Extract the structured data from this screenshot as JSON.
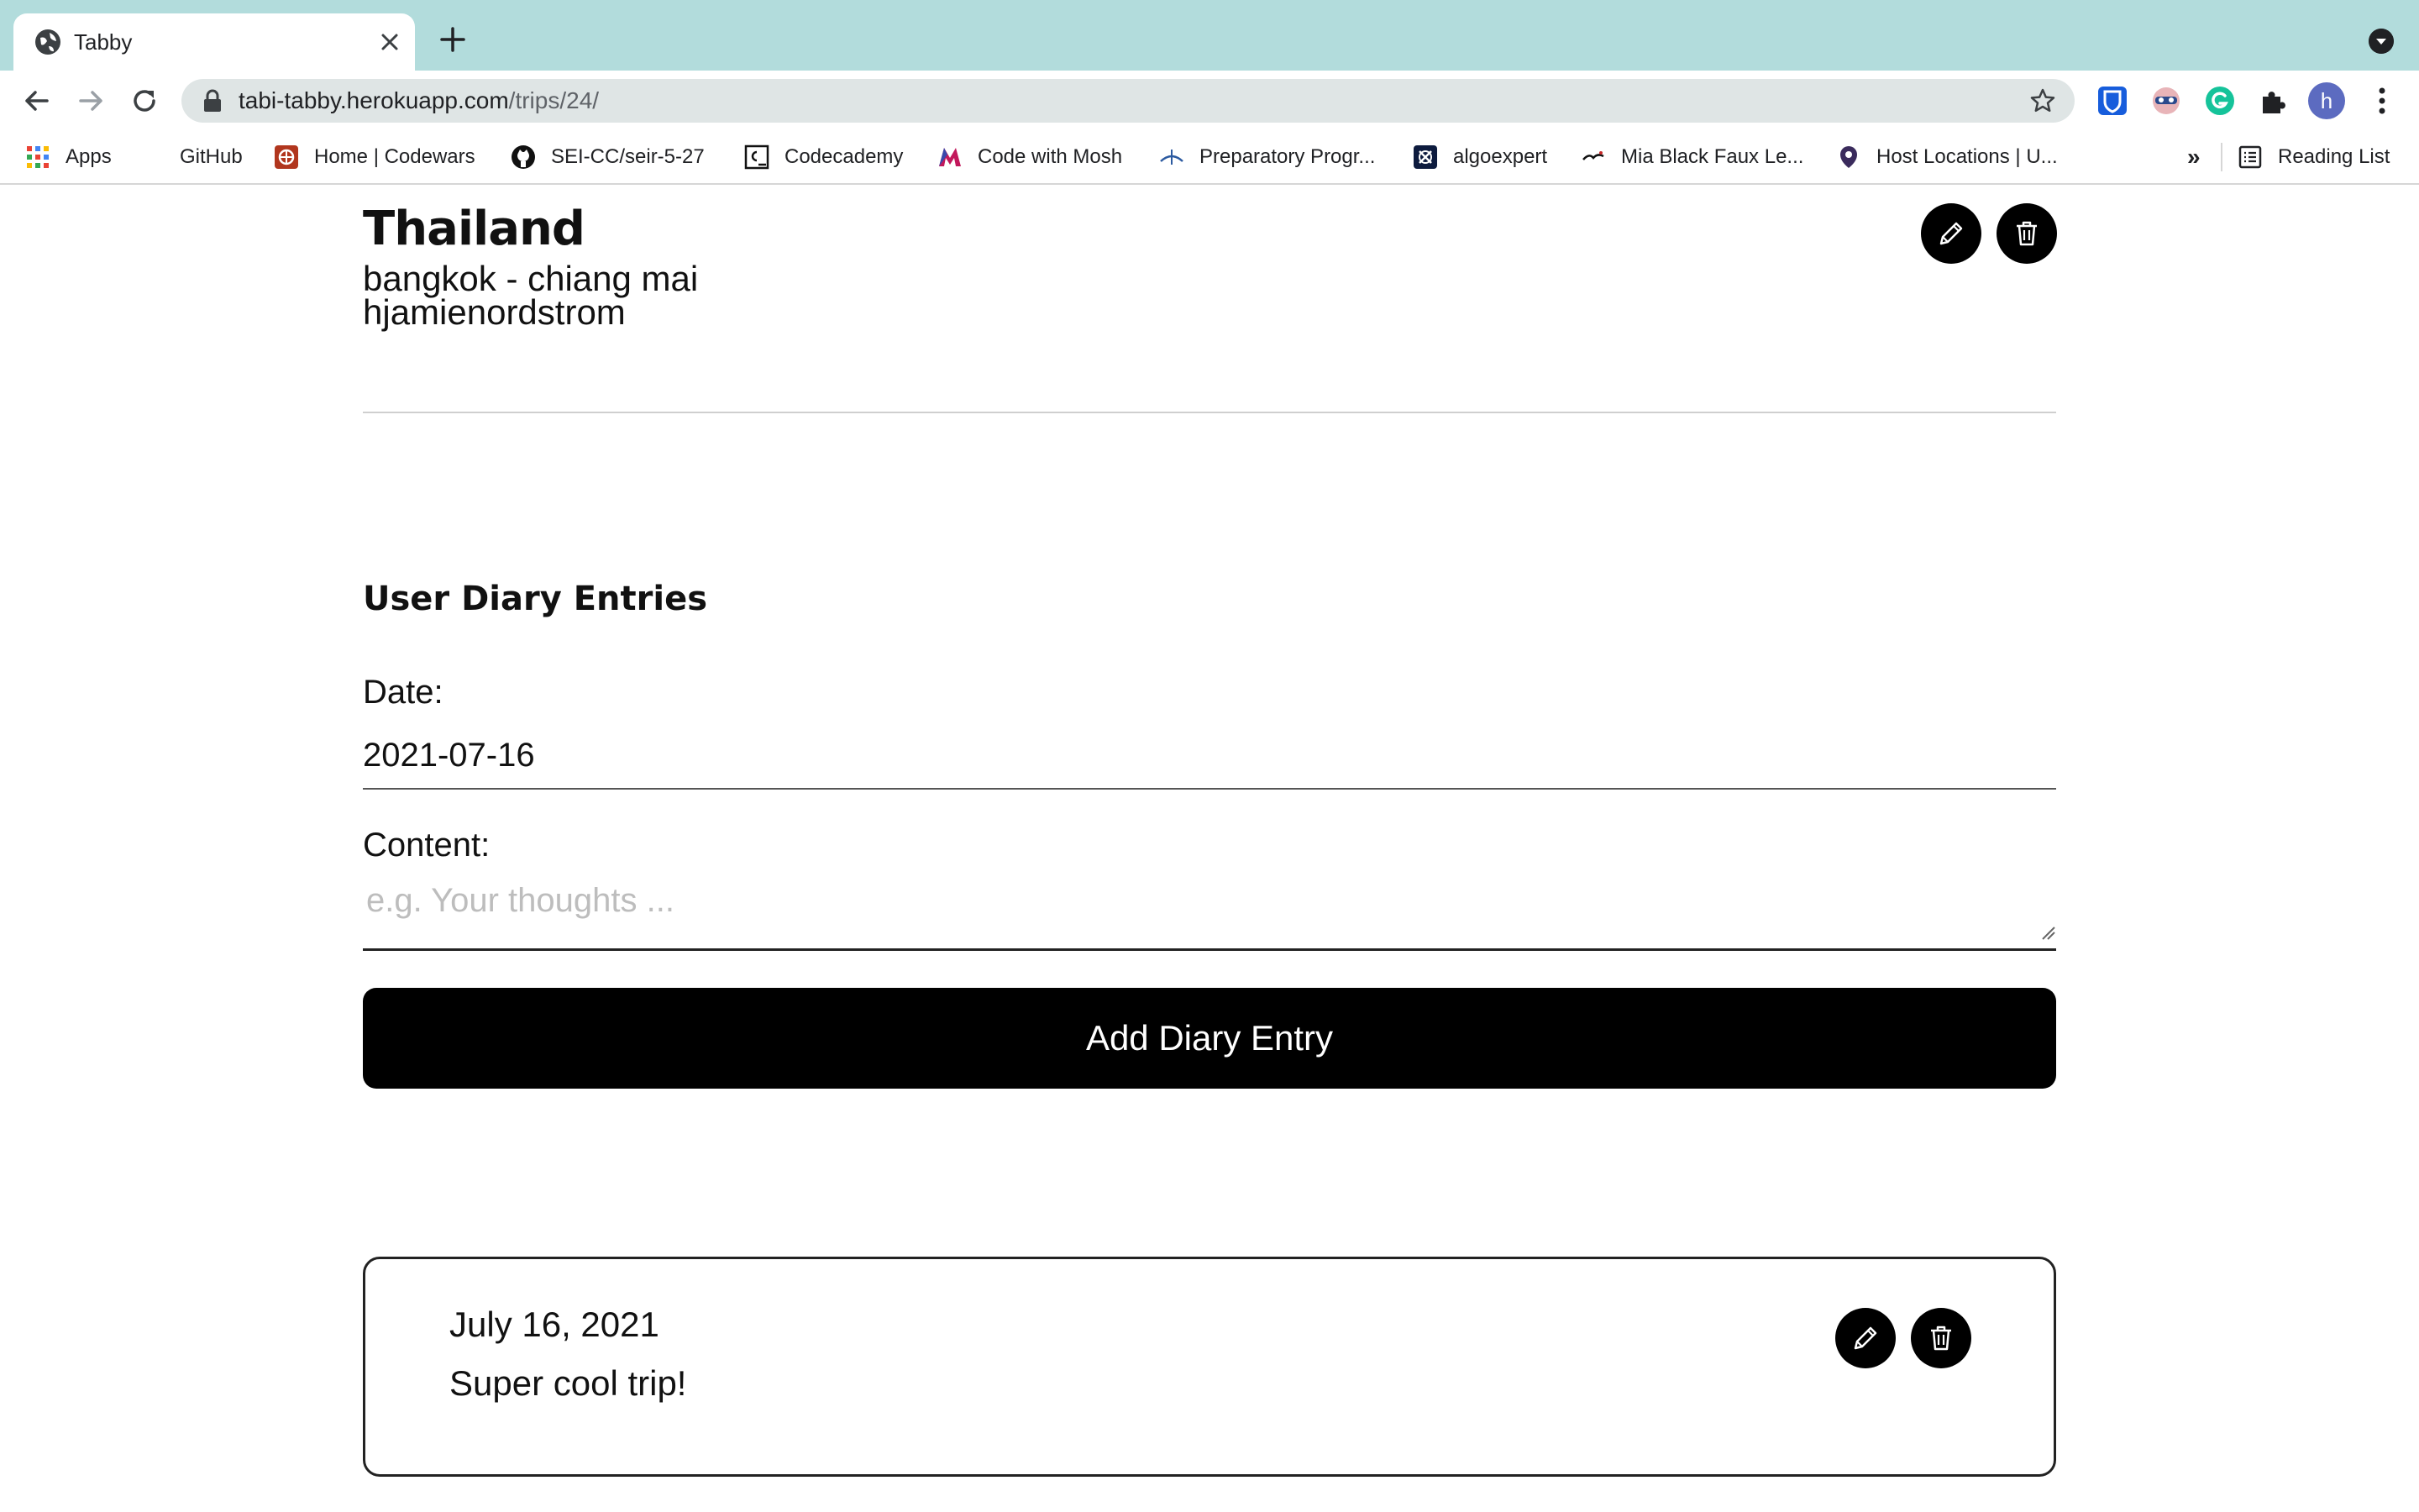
{
  "browser": {
    "tab_title": "Tabby",
    "url_host": "tabi-tabby.herokuapp.com",
    "url_path": "/trips/24/",
    "profile_initial": "h",
    "bookmarks": [
      {
        "label": "Apps",
        "icon": "apps-grid-icon"
      },
      {
        "label": "GitHub",
        "icon": "github-icon"
      },
      {
        "label": "Home | Codewars",
        "icon": "codewars-icon"
      },
      {
        "label": "SEI-CC/seir-5-27",
        "icon": "github-icon"
      },
      {
        "label": "Codecademy",
        "icon": "codecademy-icon"
      },
      {
        "label": "Code with Mosh",
        "icon": "mosh-icon"
      },
      {
        "label": "Preparatory Progr...",
        "icon": "prep-icon"
      },
      {
        "label": "algoexpert",
        "icon": "algoexpert-icon"
      },
      {
        "label": "Mia Black Faux Le...",
        "icon": "shop-icon"
      },
      {
        "label": "Host Locations | U...",
        "icon": "location-pin-icon"
      }
    ],
    "bookmarks_overflow": "»",
    "reading_list": "Reading List"
  },
  "trip": {
    "title": "Thailand",
    "route": "bangkok - chiang mai",
    "author": "hjamienordstrom"
  },
  "diary_form": {
    "heading": "User Diary Entries",
    "date_label": "Date:",
    "date_value": "2021-07-16",
    "content_label": "Content:",
    "content_placeholder": "e.g. Your thoughts ...",
    "submit_label": "Add Diary Entry"
  },
  "entries": [
    {
      "date": "July 16, 2021",
      "text": "Super cool trip!"
    }
  ],
  "colors": {
    "tabstrip": "#b2dcdc",
    "button": "#000000",
    "text": "#111111"
  }
}
